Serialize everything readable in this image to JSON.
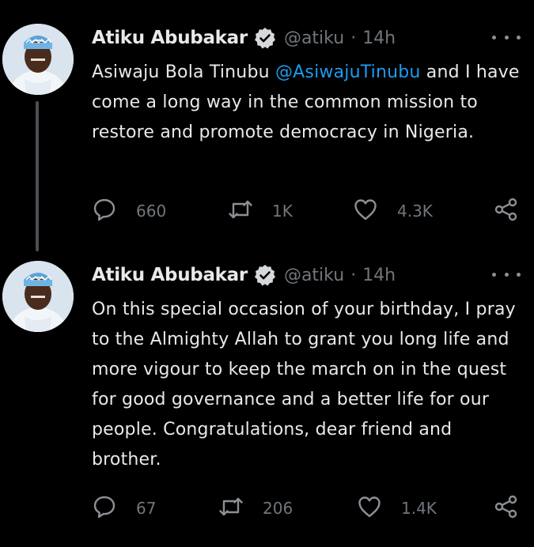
{
  "tweets": [
    {
      "author_name": "Atiku Abubakar",
      "handle": "@atiku",
      "separator": "·",
      "time": "14h",
      "text_before": "Asiwaju Bola Tinubu ",
      "mention": "@AsiwajuTinubu",
      "text_after": " and I have come a long way in the common mission to restore and promote democracy in Nigeria.",
      "replies": "660",
      "retweets": "1K",
      "likes": "4.3K"
    },
    {
      "author_name": "Atiku Abubakar",
      "handle": "@atiku",
      "separator": "·",
      "time": "14h",
      "text": "On this special occasion of your birthday, I pray to the Almighty Allah to grant you long life and more vigour to keep the march on in the quest for good governance and a better life for our people. Congratulations, dear friend and brother.",
      "replies": "67",
      "retweets": "206",
      "likes": "1.4K"
    }
  ],
  "icons": {
    "more": "more-horizontal-icon",
    "verified": "verified-badge-icon",
    "reply": "reply-icon",
    "retweet": "retweet-icon",
    "like": "like-icon",
    "share": "share-icon"
  },
  "colors": {
    "background": "#000000",
    "text": "#e7e9ea",
    "secondary": "#71767b",
    "mention": "#1d9bf0",
    "thread_line": "#4a4f55"
  }
}
